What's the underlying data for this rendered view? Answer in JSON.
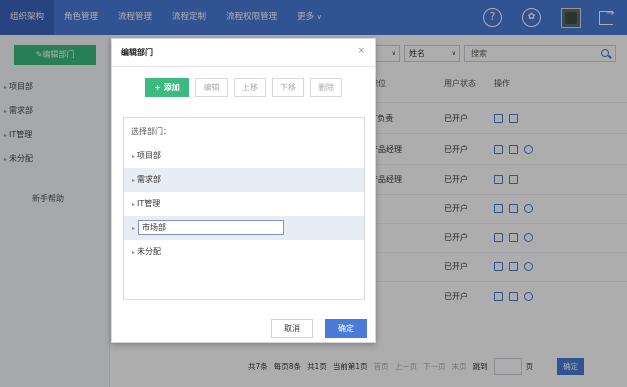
{
  "nav": {
    "tabs": [
      "组织架构",
      "角色管理",
      "流程管理",
      "流程定制",
      "流程权限管理",
      "更多"
    ],
    "more_arrow": "∨",
    "help_icon": "?"
  },
  "sidebar": {
    "edit_button": "编辑部门",
    "tree": [
      "项目部",
      "需求部",
      "IT管理",
      "未分配"
    ],
    "help": "新手帮助"
  },
  "filter": {
    "status_select": "态",
    "field_select": "姓名",
    "search_placeholder": "搜索"
  },
  "table": {
    "headers": [
      "职位",
      "用户状态",
      "操作"
    ],
    "rows": [
      {
        "position": "IT负责",
        "status": "已开户",
        "ops": [
          "edit",
          "lock"
        ]
      },
      {
        "position": "产品经理",
        "status": "已开户",
        "ops": [
          "edit",
          "lock",
          "view"
        ]
      },
      {
        "position": "产品经理",
        "status": "已开户",
        "ops": [
          "edit",
          "lock"
        ]
      },
      {
        "position": "",
        "status": "已开户",
        "ops": [
          "edit",
          "lock",
          "view"
        ]
      },
      {
        "position": "",
        "status": "已开户",
        "ops": [
          "edit",
          "lock",
          "view"
        ]
      },
      {
        "position": "",
        "status": "已开户",
        "ops": [
          "edit",
          "lock",
          "view"
        ]
      },
      {
        "position": "",
        "status": "已开户",
        "ops": [
          "edit",
          "lock",
          "view"
        ]
      }
    ]
  },
  "pager": {
    "total": "共7条",
    "per_page": "每页8条",
    "pages": "共1页",
    "current": "当前第1页",
    "first": "首页",
    "prev": "上一页",
    "next": "下一页",
    "last": "末页",
    "jump": "跳到",
    "page_unit": "页",
    "go": "确定"
  },
  "modal": {
    "title": "编辑部门",
    "close": "×",
    "toolbar": {
      "add": "+ 添加",
      "edit": "编辑",
      "up": "上移",
      "down": "下移",
      "delete": "删除"
    },
    "tree_title": "选择部门：",
    "tree": [
      "项目部",
      "需求部",
      "IT管理",
      "市场部",
      "未分配"
    ],
    "editing_value": "市场部",
    "cancel": "取消",
    "ok": "确定"
  }
}
